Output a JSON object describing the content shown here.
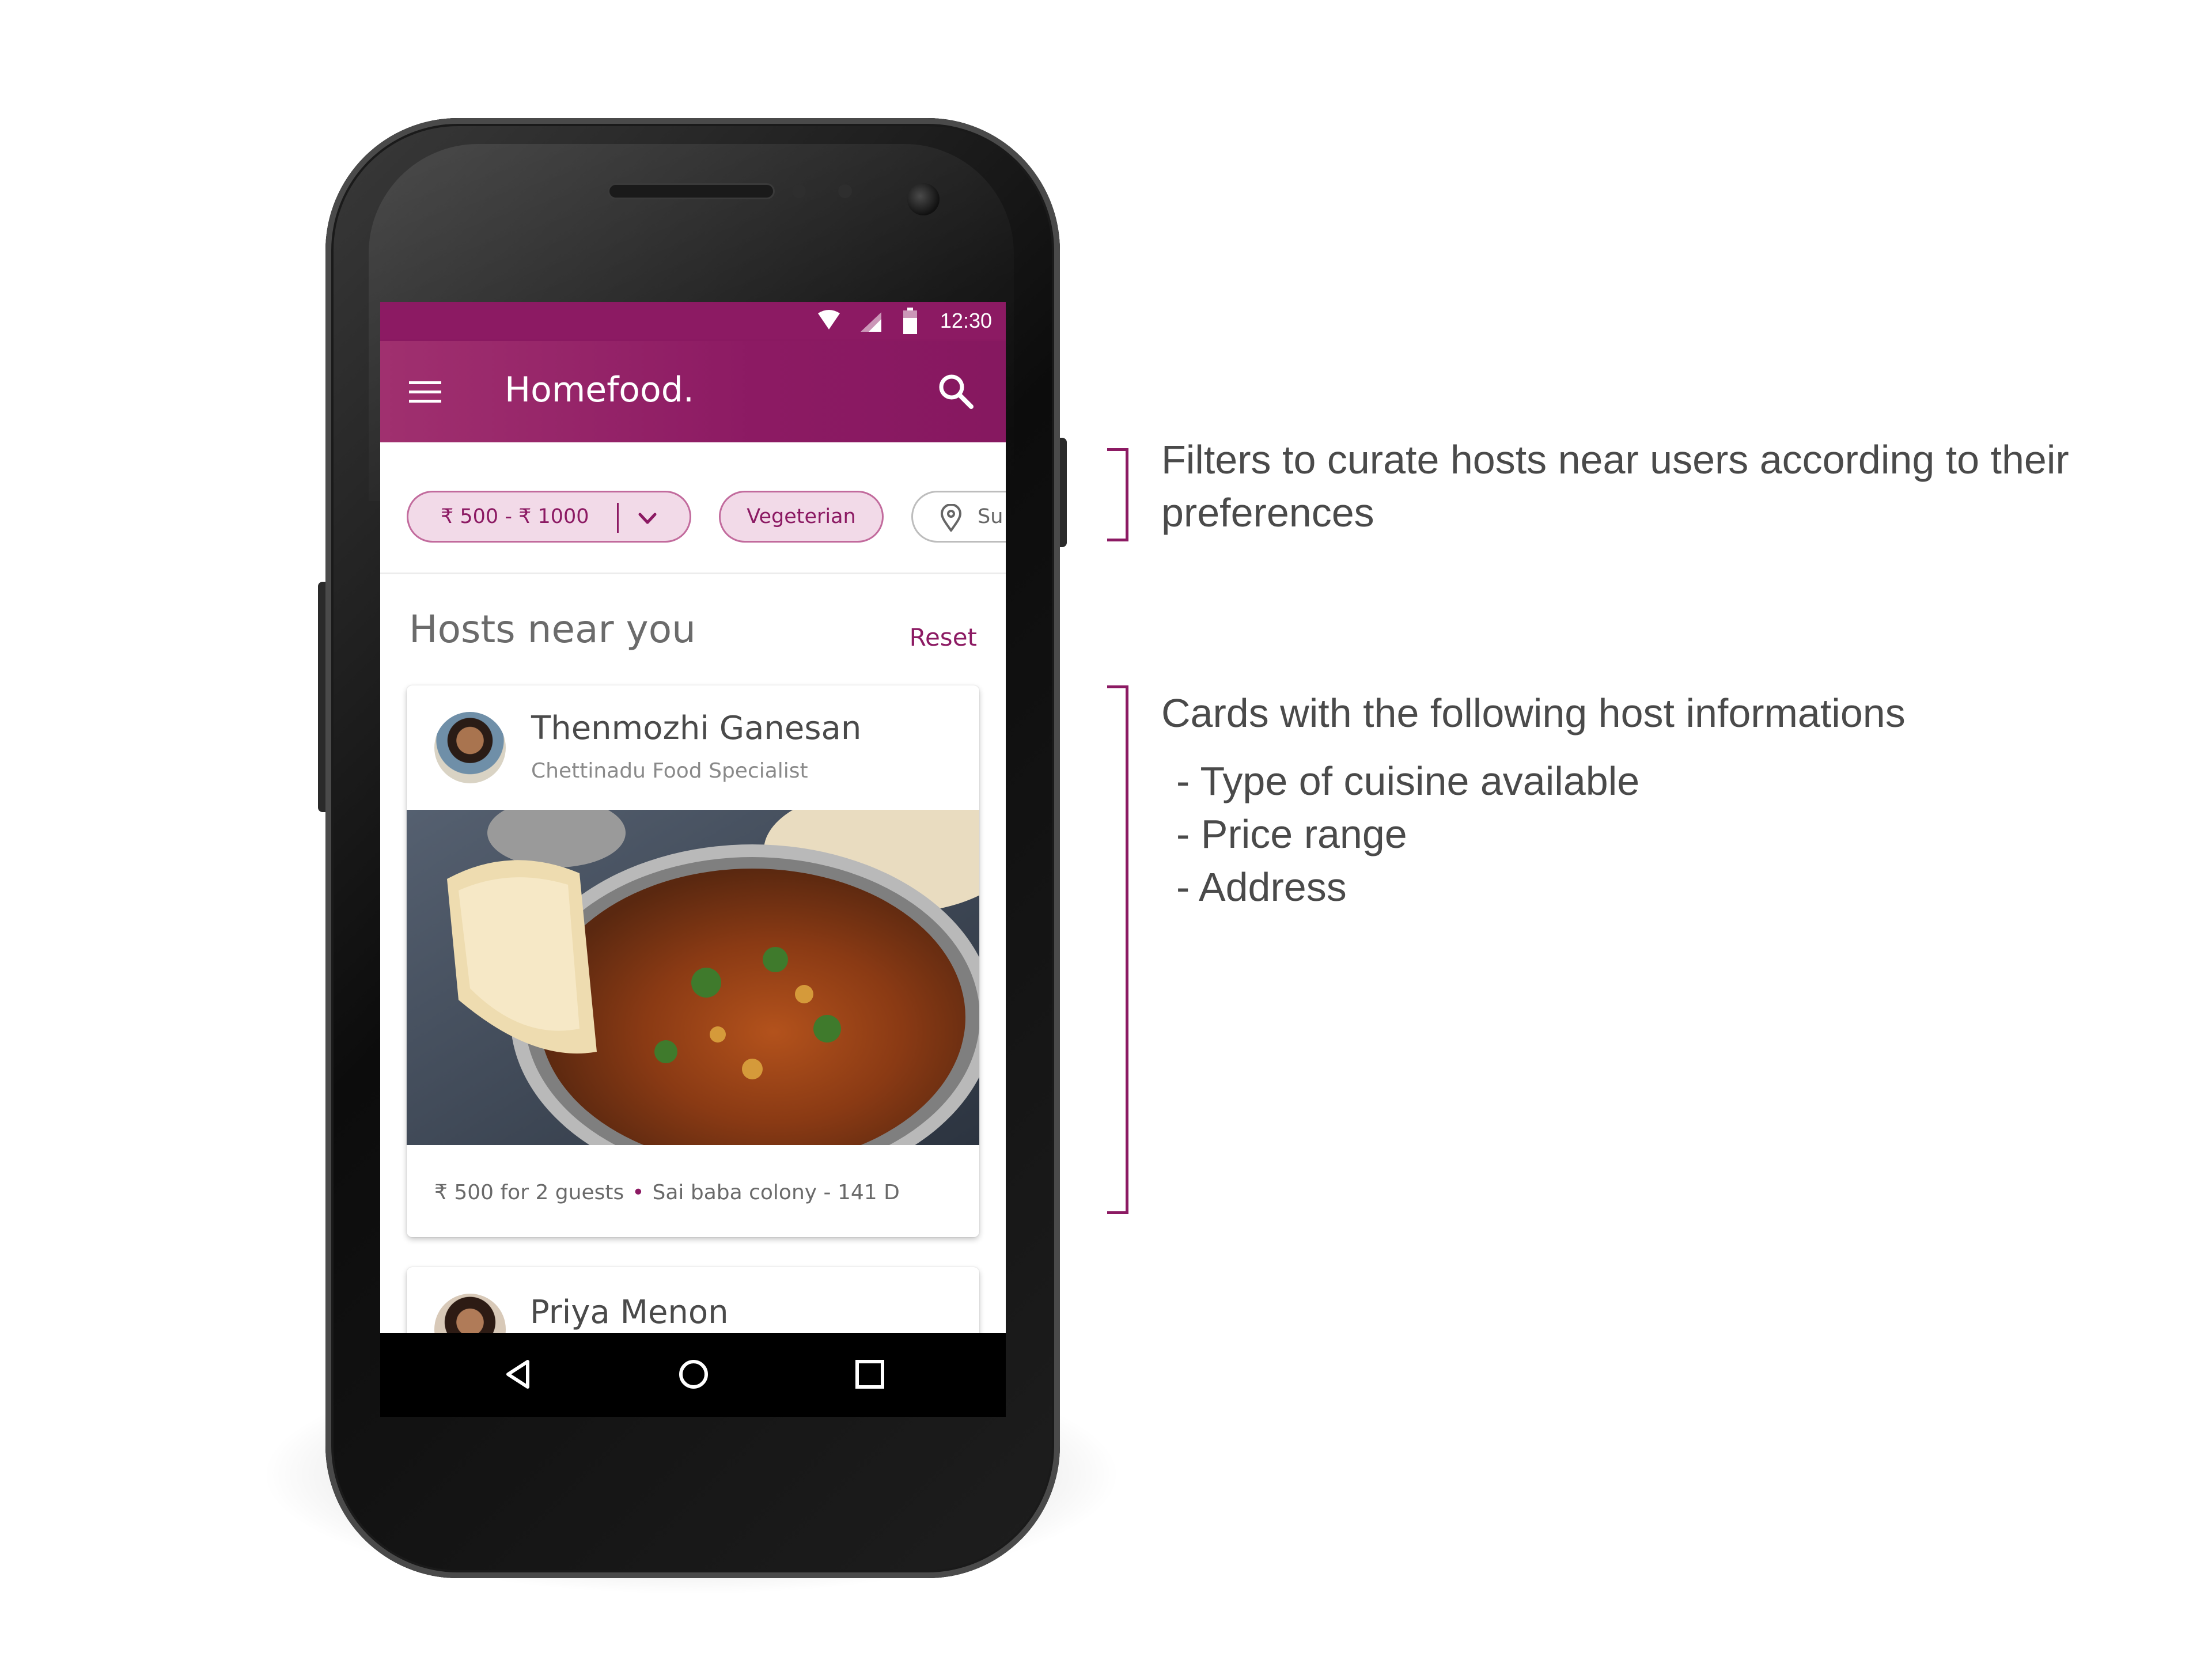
{
  "status_bar": {
    "time": "12:30"
  },
  "app_bar": {
    "title": "Homefood."
  },
  "filters": {
    "price_range": "₹ 500 -  ₹ 1000",
    "diet": "Vegeterian",
    "location": "Su"
  },
  "section": {
    "title": "Hosts near you",
    "reset_label": "Reset"
  },
  "hosts": [
    {
      "name": "Thenmozhi Ganesan",
      "specialty": "Chettinadu Food Specialist",
      "price": "₹ 500 for 2 guests",
      "address": "Sai baba colony - 141 D"
    },
    {
      "name": "Priya Menon"
    }
  ],
  "annotations": {
    "filters_note": [
      "Filters to curate hosts near users according to their",
      "preferences"
    ],
    "cards_note_title": "Cards with the following  host informations",
    "cards_note_items": [
      "- Type of cuisine available",
      "- Price range",
      "- Address"
    ]
  },
  "colors": {
    "primary": "#8c1a63",
    "chip_fill": "#f2dae8"
  }
}
